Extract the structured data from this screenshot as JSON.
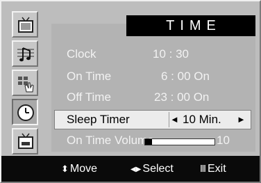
{
  "menu": {
    "title": "TIME",
    "sidebar": [
      {
        "icon": "tv-picture-icon"
      },
      {
        "icon": "music-note-icon"
      },
      {
        "icon": "channel-hand-icon"
      },
      {
        "icon": "clock-icon",
        "active": true
      },
      {
        "icon": "setup-tv-icon"
      }
    ],
    "rows": {
      "clock": {
        "label": "Clock",
        "value": "10 : 30"
      },
      "on_time": {
        "label": "On Time",
        "value": "6 : 00 On"
      },
      "off_time": {
        "label": "Off Time",
        "value": "23 : 00 On"
      },
      "sleep_timer": {
        "label": "Sleep Timer",
        "left_arrow": "◄",
        "value": "10 Min.",
        "right_arrow": "►"
      },
      "on_time_volume": {
        "label": "On Time Volume",
        "value": "10",
        "level_fraction": 0.1
      }
    },
    "footer": {
      "move_icon": "⬍",
      "move_label": "Move",
      "select_icon": "◀▶",
      "select_label": "Select",
      "exit_icon": "Ⅲ",
      "exit_label": "Exit"
    }
  }
}
